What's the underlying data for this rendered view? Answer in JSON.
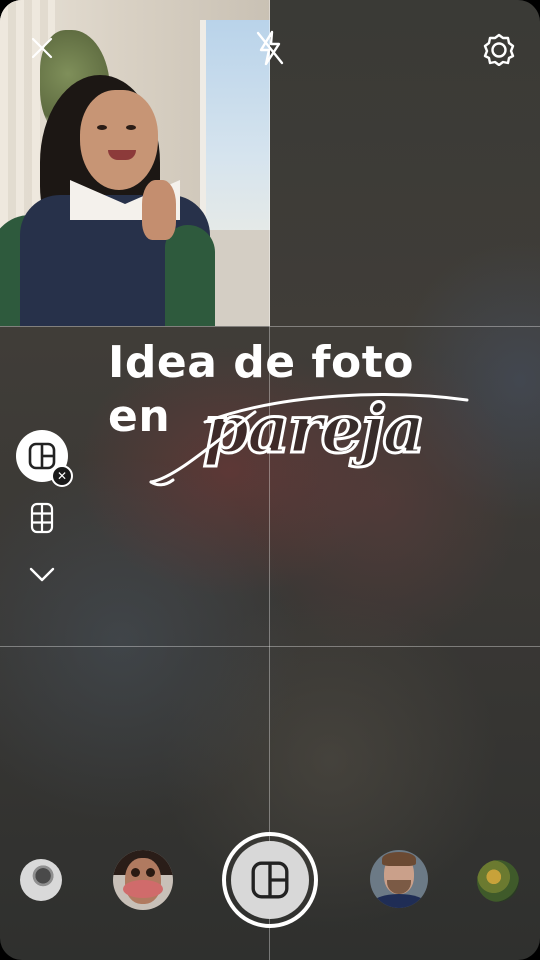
{
  "headline": {
    "line1": "Idea de foto",
    "line2_prefix": "en",
    "script_word": "pareja"
  },
  "top_bar": {
    "icons": [
      "close-icon",
      "flash-off-icon",
      "settings-icon"
    ]
  },
  "layout_tools": {
    "selected_icon": "layout-split-icon",
    "options": [
      "grid-6-icon",
      "chevron-down-icon"
    ]
  },
  "bottom_bar": {
    "effects": [
      "effect-1",
      "effect-2",
      "effect-3",
      "effect-4"
    ],
    "shutter_icon": "layout-split-icon"
  },
  "colors": {
    "accent": "#ffffff",
    "background": "#3a3935"
  }
}
